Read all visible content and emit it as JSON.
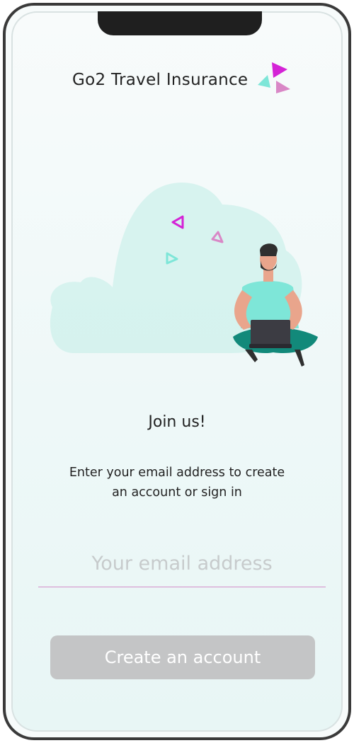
{
  "app": {
    "title": "Go2 Travel Insurance",
    "logo_icon": "triangles-logo-icon"
  },
  "colors": {
    "accent_magenta": "#d423d6",
    "accent_teal": "#7ee6d8",
    "accent_pink": "#d987c6",
    "input_underline": "#d38bc9",
    "button_disabled": "#c4c5c6"
  },
  "main": {
    "heading": "Join us!",
    "subtitle_line1": "Enter your email address to create",
    "subtitle_line2": "an account or sign in",
    "email_placeholder": "Your email address",
    "email_value": "",
    "create_button_label": "Create an account"
  },
  "illustration": {
    "subject": "person-with-laptop-illustration"
  }
}
